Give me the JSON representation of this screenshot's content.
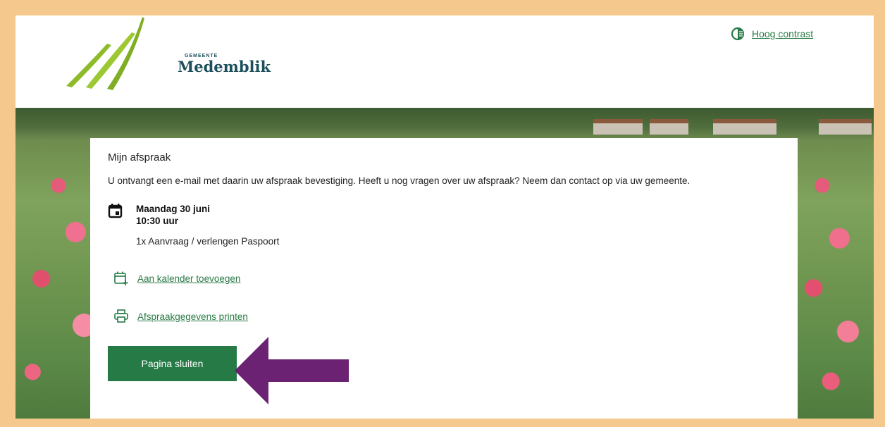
{
  "header": {
    "logo_small": "GEMEENTE",
    "logo_name": "Medemblik",
    "contrast_label": "Hoog contrast"
  },
  "card": {
    "title": "Mijn afspraak",
    "message": "U ontvangt een e-mail met daarin uw afspraak bevestiging. Heeft u nog vragen over uw afspraak? Neem dan contact op via uw gemeente.",
    "date": "Maandag 30 juni",
    "time": "10:30 uur",
    "service": "1x Aanvraag / verlengen Paspoort",
    "add_calendar_label": "Aan kalender toevoegen",
    "print_label": "Afspraakgegevens printen",
    "close_button_label": "Pagina sluiten"
  },
  "icons": {
    "contrast": "contrast-icon",
    "calendar": "calendar-icon",
    "calendar_add": "calendar-add-icon",
    "print": "printer-icon"
  },
  "colors": {
    "brand_green": "#257a46",
    "link_green": "#2a7a45",
    "frame": "#f5c98e",
    "annotation_arrow": "#6b2273"
  }
}
